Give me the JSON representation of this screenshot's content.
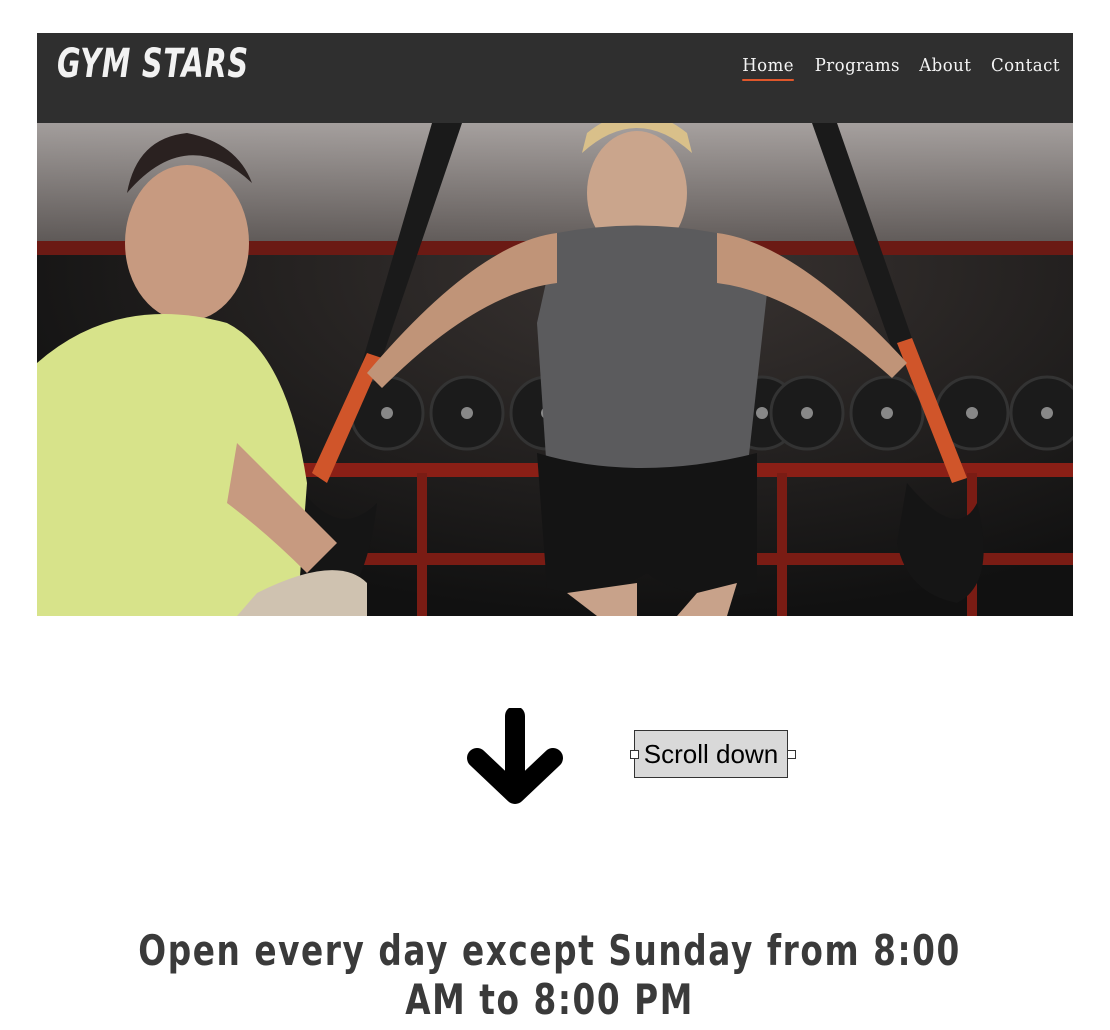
{
  "header": {
    "logo": "GYM STARS",
    "nav": [
      "Home",
      "Programs",
      "About",
      "Contact"
    ],
    "active_index": 0,
    "accent_color": "#e0572b"
  },
  "hero": {
    "icon": "gym-training-photo"
  },
  "scroll": {
    "label": "Scroll down",
    "icon": "arrow-down-icon"
  },
  "hours_text": "Open every day except Sunday from 8:00 AM to 8:00 PM"
}
